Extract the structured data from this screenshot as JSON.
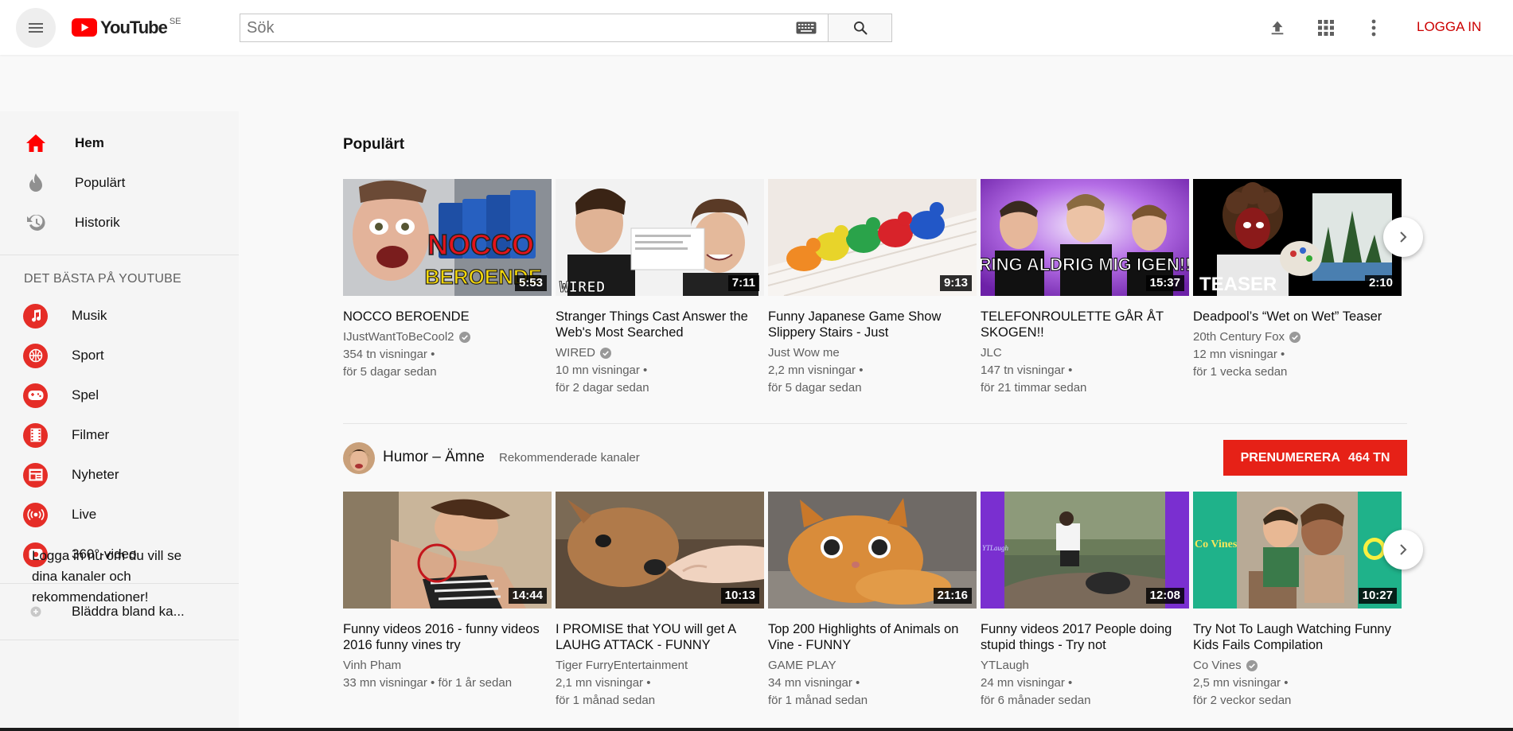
{
  "header": {
    "logo_text": "YouTube",
    "country": "SE",
    "search_placeholder": "Sök",
    "signin_label": "LOGGA IN"
  },
  "sidebar": {
    "main_items": [
      {
        "label": "Hem",
        "icon": "home-icon",
        "active": true
      },
      {
        "label": "Populärt",
        "icon": "fire-icon"
      },
      {
        "label": "Historik",
        "icon": "history-icon"
      }
    ],
    "section_title": "DET BÄSTA PÅ YOUTUBE",
    "best_items": [
      {
        "label": "Musik",
        "icon": "music-icon"
      },
      {
        "label": "Sport",
        "icon": "sport-icon"
      },
      {
        "label": "Spel",
        "icon": "gamepad-icon"
      },
      {
        "label": "Filmer",
        "icon": "film-icon"
      },
      {
        "label": "Nyheter",
        "icon": "news-icon"
      },
      {
        "label": "Live",
        "icon": "live-icon"
      },
      {
        "label": "360°-video",
        "icon": "360-icon"
      }
    ],
    "browse_label": "Bläddra bland ka...",
    "login_note": "Logga in nu om du vill se dina kanaler och rekommendationer!"
  },
  "shelf1": {
    "title": "Populärt",
    "videos": [
      {
        "title": "NOCCO BEROENDE",
        "channel": "IJustWantToBeCool2",
        "verified": true,
        "views": "354 tn visningar",
        "age": "för 5 dagar sedan",
        "duration": "5:53"
      },
      {
        "title": "Stranger Things Cast Answer the Web's Most Searched",
        "channel": "WIRED",
        "verified": true,
        "views": "10 mn visningar",
        "age": "för 2 dagar sedan",
        "duration": "7:11"
      },
      {
        "title": "Funny Japanese Game Show Slippery Stairs - Just",
        "channel": "Just Wow me",
        "verified": false,
        "views": "2,2 mn visningar",
        "age": "för 5 dagar sedan",
        "duration": "9:13"
      },
      {
        "title": "TELEFONROULETTE GÅR ÅT SKOGEN!!",
        "channel": "JLC",
        "verified": false,
        "views": "147 tn visningar",
        "age": "för 21 timmar sedan",
        "duration": "15:37"
      },
      {
        "title": "Deadpool’s “Wet on Wet” Teaser",
        "channel": "20th Century Fox",
        "verified": true,
        "views": "12 mn visningar",
        "age": "för 1 vecka sedan",
        "duration": "2:10"
      }
    ],
    "thumb_texts": {
      "v1": "NOCCO",
      "v1b": "BEROENDE",
      "v2": "WIRED",
      "v4": "\"RING ALDRIG MIG IGEN!!\"",
      "v5": "TEASER"
    }
  },
  "shelf2": {
    "channel_name": "Humor – Ämne",
    "channel_sub": "Rekommenderade kanaler",
    "subscribe_label": "PRENUMERERA",
    "subscribe_count": "464 TN",
    "videos": [
      {
        "title": "Funny videos 2016 - funny videos 2016 funny vines try",
        "channel": "Vinh Pham",
        "verified": false,
        "views": "33 mn visningar",
        "age": "för 1 år sedan",
        "duration": "14:44",
        "inline_meta": true
      },
      {
        "title": "I PROMISE that YOU will get A LAUHG ATTACK - FUNNY",
        "channel": "Tiger FurryEntertainment",
        "verified": false,
        "views": "2,1 mn visningar",
        "age": "för 1 månad sedan",
        "duration": "10:13"
      },
      {
        "title": "Top 200 Highlights of Animals on Vine - FUNNY",
        "channel": "GAME PLAY",
        "verified": false,
        "views": "34 mn visningar",
        "age": "för 1 månad sedan",
        "duration": "21:16"
      },
      {
        "title": "Funny videos 2017 People doing stupid things - Try not",
        "channel": "YTLaugh",
        "verified": false,
        "views": "24 mn visningar",
        "age": "för 6 månader sedan",
        "duration": "12:08"
      },
      {
        "title": "Try Not To Laugh Watching Funny Kids Fails Compilation",
        "channel": "Co Vines",
        "verified": true,
        "views": "2,5 mn visningar",
        "age": "för 2 veckor sedan",
        "duration": "10:27"
      }
    ],
    "thumb_texts": {
      "v4": "YTLaugh",
      "v5": "Co Vines"
    }
  },
  "colors": {
    "accent": "#ff0000",
    "signin": "#cc0000",
    "subscribe": "#e62117"
  }
}
